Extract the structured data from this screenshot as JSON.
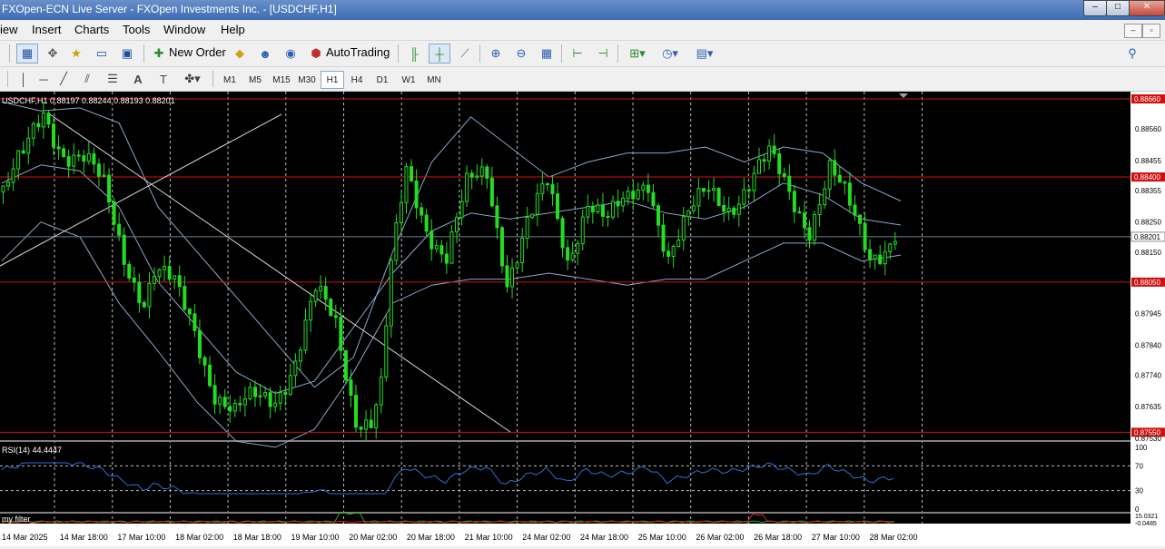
{
  "window": {
    "title": "FXOpen-ECN Live Server - FXOpen Investments Inc. - [USDCHF,H1]"
  },
  "menu": [
    "iew",
    "Insert",
    "Charts",
    "Tools",
    "Window",
    "Help"
  ],
  "toolbar": {
    "new_order": "New Order",
    "autotrading": "AutoTrading",
    "notifications": "1"
  },
  "timeframes": [
    "M1",
    "M5",
    "M15",
    "M30",
    "H1",
    "H4",
    "D1",
    "W1",
    "MN"
  ],
  "active_timeframe": "H1",
  "chart_data": [
    {
      "type": "candlestick",
      "title": "USDCHF,H1  0.88197 0.88244 0.88193 0.88201",
      "ylim": [
        0.8753,
        0.8866
      ],
      "y_ticks": [
        "0.88560",
        "0.88455",
        "0.88355",
        "0.88250",
        "0.88150",
        "0.87945",
        "0.87840",
        "0.87740",
        "0.87635",
        "0.87530"
      ],
      "current_price": "0.88201",
      "horizontal_levels": [
        {
          "label": "0.88660",
          "value": 0.8866
        },
        {
          "label": "0.88400",
          "value": 0.884
        },
        {
          "label": "0.88050",
          "value": 0.8805
        },
        {
          "label": "0.87550",
          "value": 0.8755
        }
      ],
      "x_ticks": [
        "14 Mar 2025",
        "14 Mar 18:00",
        "17 Mar 10:00",
        "18 Mar 02:00",
        "18 Mar 18:00",
        "19 Mar 10:00",
        "20 Mar 02:00",
        "20 Mar 18:00",
        "21 Mar 10:00",
        "24 Mar 02:00",
        "24 Mar 18:00",
        "25 Mar 10:00",
        "26 Mar 02:00",
        "26 Mar 18:00",
        "27 Mar 10:00",
        "28 Mar 02:00"
      ],
      "close_path": [
        [
          0.8835,
          0
        ],
        [
          0.8845,
          4
        ],
        [
          0.8862,
          8
        ],
        [
          0.885,
          12
        ],
        [
          0.8845,
          16
        ],
        [
          0.8835,
          20
        ],
        [
          0.8815,
          24
        ],
        [
          0.88,
          28
        ],
        [
          0.8808,
          30
        ],
        [
          0.8802,
          34
        ],
        [
          0.879,
          38
        ],
        [
          0.877,
          42
        ],
        [
          0.876,
          46
        ],
        [
          0.8765,
          50
        ],
        [
          0.8768,
          54
        ],
        [
          0.878,
          58
        ],
        [
          0.88,
          62
        ],
        [
          0.879,
          66
        ],
        [
          0.8762,
          70
        ],
        [
          0.876,
          73
        ],
        [
          0.877,
          75
        ],
        [
          0.8808,
          77
        ],
        [
          0.884,
          80
        ],
        [
          0.8825,
          84
        ],
        [
          0.8815,
          88
        ],
        [
          0.8835,
          92
        ],
        [
          0.884,
          96
        ],
        [
          0.8808,
          100
        ],
        [
          0.8825,
          104
        ],
        [
          0.8835,
          108
        ],
        [
          0.8812,
          112
        ],
        [
          0.8835,
          116
        ],
        [
          0.8825,
          120
        ],
        [
          0.883,
          124
        ],
        [
          0.884,
          128
        ],
        [
          0.8815,
          132
        ],
        [
          0.8825,
          136
        ],
        [
          0.8835,
          140
        ],
        [
          0.8832,
          144
        ],
        [
          0.8838,
          148
        ],
        [
          0.8845,
          152
        ],
        [
          0.8835,
          156
        ],
        [
          0.8825,
          160
        ],
        [
          0.8842,
          164
        ],
        [
          0.8828,
          168
        ],
        [
          0.8815,
          172
        ],
        [
          0.882,
          176
        ],
        [
          0.8825,
          178
        ]
      ],
      "bollinger_upper": [
        0.8865,
        0.8862,
        0.8863,
        0.8858,
        0.883,
        0.8815,
        0.88,
        0.8785,
        0.877,
        0.878,
        0.8815,
        0.8845,
        0.886,
        0.885,
        0.884,
        0.8845,
        0.8848,
        0.8848,
        0.885,
        0.8845,
        0.885,
        0.8848,
        0.8838,
        0.8832
      ],
      "bollinger_middle": [
        0.8838,
        0.8844,
        0.8842,
        0.883,
        0.8805,
        0.879,
        0.8775,
        0.8768,
        0.8772,
        0.879,
        0.8808,
        0.8822,
        0.8828,
        0.8826,
        0.8828,
        0.883,
        0.8832,
        0.8828,
        0.8826,
        0.883,
        0.8838,
        0.8834,
        0.8826,
        0.8824
      ],
      "bollinger_lower": [
        0.8812,
        0.8825,
        0.882,
        0.8798,
        0.8782,
        0.8765,
        0.8752,
        0.875,
        0.8756,
        0.8775,
        0.8798,
        0.8804,
        0.8806,
        0.8806,
        0.8808,
        0.8806,
        0.8804,
        0.8806,
        0.8806,
        0.8812,
        0.8818,
        0.8818,
        0.8812,
        0.8814
      ],
      "indicators": [
        {
          "name": "RSI(14) 44.4447",
          "levels": [
            "100",
            "70",
            "30",
            "0"
          ]
        },
        {
          "name": "my filter_",
          "levels": [
            "15.0321",
            "-0.0485"
          ]
        }
      ]
    }
  ]
}
